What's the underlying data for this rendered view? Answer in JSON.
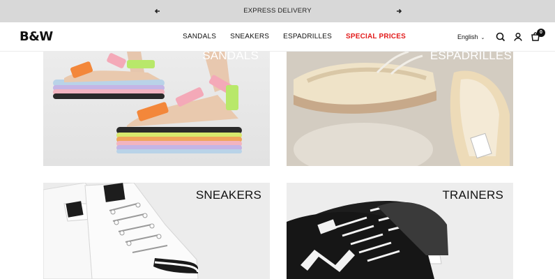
{
  "announcement": {
    "prev_icon": "arrow-left-icon",
    "text": "EXPRESS DELIVERY",
    "next_icon": "arrow-right-icon"
  },
  "header": {
    "logo": "B&W",
    "nav": [
      {
        "label": "SANDALS"
      },
      {
        "label": "SNEAKERS"
      },
      {
        "label": "ESPADRILLES"
      },
      {
        "label": "SPECIAL PRICES",
        "color": "#e21b1b"
      }
    ],
    "language": "English",
    "icons": [
      "search-icon",
      "account-icon",
      "cart-icon"
    ],
    "cart_count": "0"
  },
  "tiles": [
    {
      "label": "SANDALS"
    },
    {
      "label": "ESPADRILLES"
    },
    {
      "label": "SNEAKERS"
    },
    {
      "label": "TRAINERS"
    }
  ],
  "colors": {
    "announcement_bg": "#d8d8d8",
    "special_prices": "#e21b1b",
    "text": "#111111"
  }
}
